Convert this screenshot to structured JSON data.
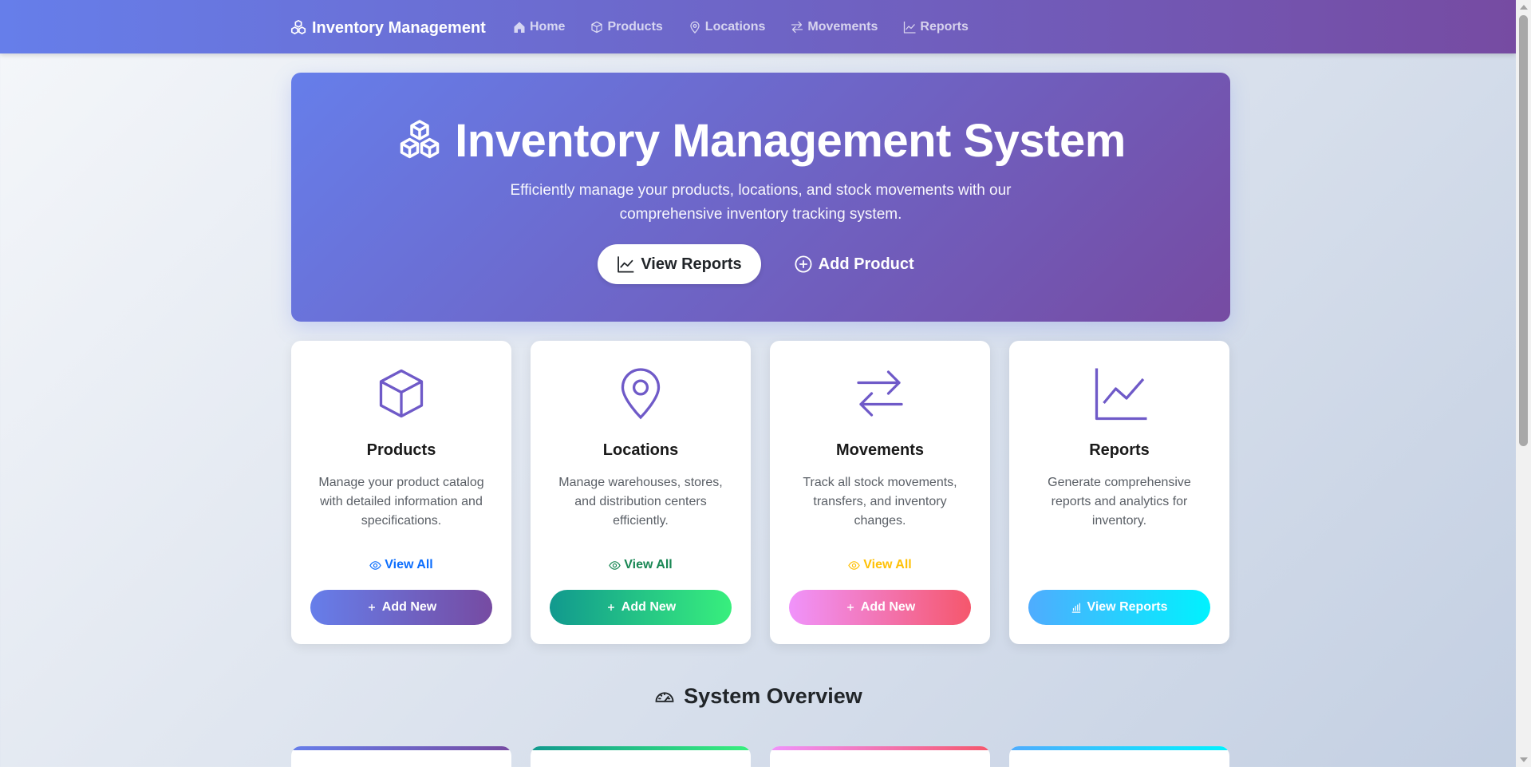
{
  "navbar": {
    "brand": "Inventory Management",
    "links": [
      {
        "label": "Home",
        "icon": "house-icon"
      },
      {
        "label": "Products",
        "icon": "box-icon"
      },
      {
        "label": "Locations",
        "icon": "map-pin-icon"
      },
      {
        "label": "Movements",
        "icon": "arrows-exchange-icon"
      },
      {
        "label": "Reports",
        "icon": "chart-line-icon"
      }
    ]
  },
  "hero": {
    "title": "Inventory Management System",
    "subtitle_line1": "Efficiently manage your products, locations, and stock movements with our",
    "subtitle_line2": "comprehensive inventory tracking system.",
    "primary_button": "View Reports",
    "secondary_button": "Add Product"
  },
  "cards": [
    {
      "title": "Products",
      "description": "Manage your product catalog with detailed information and specifications.",
      "view_all": "View All",
      "action": "Add New",
      "icon": "box-icon",
      "link_color": "#0d6efd",
      "gradient": [
        "#667eea",
        "#764ba2"
      ]
    },
    {
      "title": "Locations",
      "description": "Manage warehouses, stores, and distribution centers efficiently.",
      "view_all": "View All",
      "action": "Add New",
      "icon": "map-pin-icon",
      "link_color": "#198754",
      "gradient": [
        "#11998e",
        "#38ef7d"
      ]
    },
    {
      "title": "Movements",
      "description": "Track all stock movements, transfers, and inventory changes.",
      "view_all": "View All",
      "action": "Add New",
      "icon": "arrows-exchange-icon",
      "link_color": "#ffc107",
      "gradient": [
        "#f093fb",
        "#f5576c"
      ]
    },
    {
      "title": "Reports",
      "description": "Generate comprehensive reports and analytics for inventory.",
      "action": "View Reports",
      "icon": "chart-line-icon",
      "gradient": [
        "#4facfe",
        "#00f2fe"
      ]
    }
  ],
  "overview": {
    "title": "System Overview",
    "icon": "speedometer-icon"
  },
  "colors": {
    "primary_gradient": [
      "#667eea",
      "#764ba2"
    ],
    "icon_purple": "#6f5ac8"
  }
}
